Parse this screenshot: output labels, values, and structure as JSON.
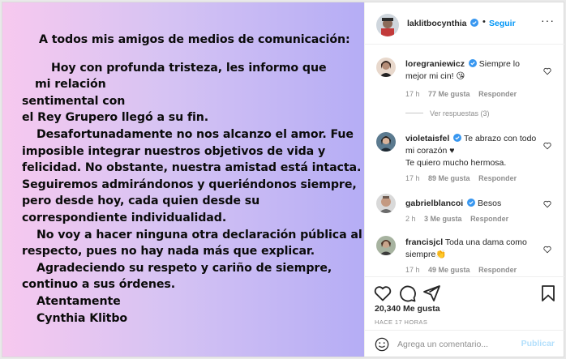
{
  "post": {
    "lines": [
      "A todos mis amigos de medios de comunicación:",
      "Hoy con profunda tristeza, les informo que",
      "mi relación",
      "sentimental con",
      "el Rey Grupero llegó a su fin.",
      "Desafortunadamente no nos alcanzo el amor. Fue",
      "imposible integrar nuestros objetivos de vida y",
      "felicidad. No obstante, nuestra amistad está intacta.",
      "Seguiremos admirándonos y queriéndonos siempre,",
      "pero desde hoy, cada quien desde su",
      "correspondiente individualidad.",
      "No voy a hacer ninguna otra declaración pública al",
      "respecto, pues no hay nada más que explicar.",
      "Agradeciendo su respeto y cariño de siempre,",
      "continuo a sus órdenes.",
      "Atentamente",
      "Cynthia Klitbo"
    ]
  },
  "header": {
    "username": "laklitbocynthia",
    "dot": "•",
    "follow": "Seguir",
    "more": "···"
  },
  "comments": [
    {
      "username": "loregraniewicz",
      "text": "Siempre lo mejor mi cin! 😘",
      "time": "17 h",
      "likes": "77 Me gusta",
      "reply": "Responder",
      "view_replies": "Ver respuestas (3)"
    },
    {
      "username": "violetaisfel",
      "text": "Te abrazo con todo mi corazón ♥",
      "text2": "Te quiero mucho hermosa.",
      "time": "17 h",
      "likes": "89 Me gusta",
      "reply": "Responder"
    },
    {
      "username": "gabrielblancoi",
      "text": "Besos",
      "time": "2 h",
      "likes": "3 Me gusta",
      "reply": "Responder"
    },
    {
      "username": "francisjcl",
      "text": "Toda una dama como siempre👏",
      "time": "17 h",
      "likes": "49 Me gusta",
      "reply": "Responder"
    }
  ],
  "footer": {
    "likes": "20,340 Me gusta",
    "time": "HACE 17 HORAS",
    "comment_placeholder": "Agrega un comentario...",
    "publish": "Publicar"
  },
  "icons": {
    "like": "heart-icon",
    "comment": "comment-icon",
    "share": "share-icon",
    "save": "bookmark-icon",
    "emoji": "emoji-icon",
    "verified": "verified-badge-icon"
  },
  "colors": {
    "link_blue": "#0095f6",
    "publish_disabled": "#b2dffc",
    "muted": "#8e8e8e",
    "verified": "#3897f0"
  }
}
